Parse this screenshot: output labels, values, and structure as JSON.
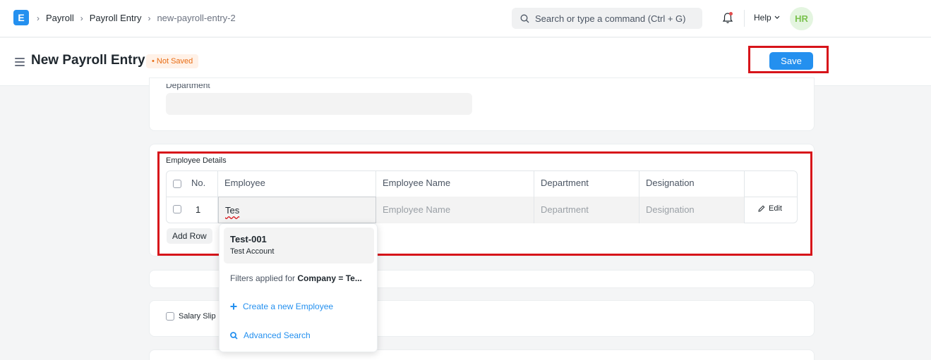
{
  "navbar": {
    "logo": "E",
    "breadcrumbs": [
      "Payroll",
      "Payroll Entry",
      "new-payroll-entry-2"
    ],
    "search_placeholder": "Search or type a command (Ctrl + G)",
    "help_label": "Help",
    "avatar_initials": "HR"
  },
  "page": {
    "title": "New Payroll Entry",
    "status_badge": "Not Saved",
    "save_label": "Save"
  },
  "department_section": {
    "label": "Department"
  },
  "employee_details": {
    "label": "Employee Details",
    "columns": [
      "No.",
      "Employee",
      "Employee Name",
      "Department",
      "Designation"
    ],
    "rows": [
      {
        "no": "1",
        "employee": "Tes",
        "employee_name_placeholder": "Employee Name",
        "department_placeholder": "Department",
        "designation_placeholder": "Designation"
      }
    ],
    "edit_label": "Edit",
    "add_row_label": "Add Row"
  },
  "salary_slip_label": "Salary Slip",
  "autocomplete": {
    "item_value": "Test-001",
    "item_description": "Test Account",
    "filter_prefix": "Filters applied for ",
    "filter_field": "Company",
    "filter_rest": " = Te...",
    "create_label": "Create a new Employee",
    "advanced_label": "Advanced Search"
  },
  "colors": {
    "accent": "#2490ef",
    "highlight_frame": "#d7141a",
    "badge_text": "#e86c13"
  }
}
